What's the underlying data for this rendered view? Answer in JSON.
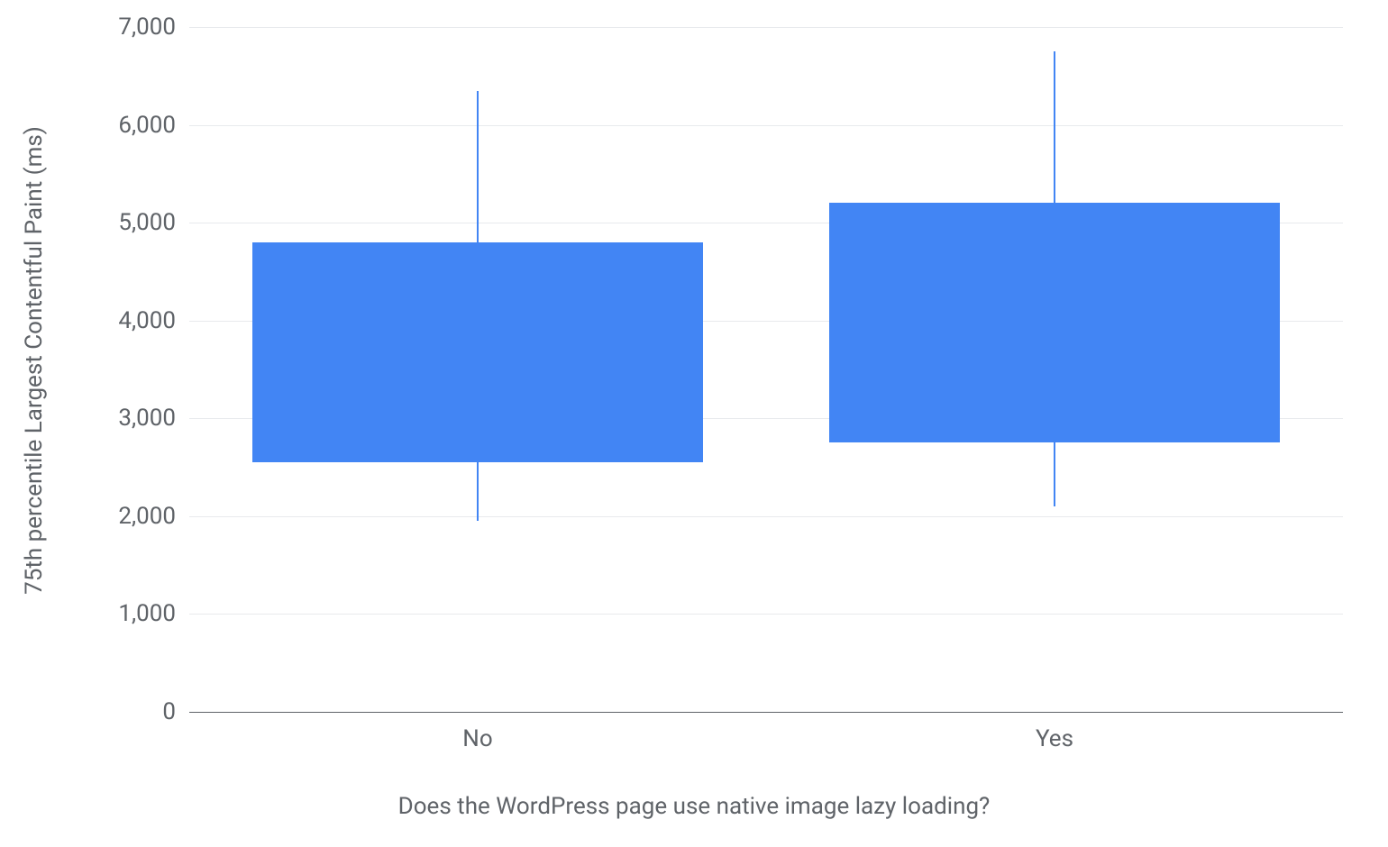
{
  "chart_data": {
    "type": "box",
    "xlabel": "Does the WordPress page use native image lazy loading?",
    "ylabel": "75th percentile Largest Contentful Paint (ms)",
    "ylim": [
      0,
      7000
    ],
    "y_ticks": [
      0,
      1000,
      2000,
      3000,
      4000,
      5000,
      6000,
      7000
    ],
    "y_tick_labels": [
      "0",
      "1,000",
      "2,000",
      "3,000",
      "4,000",
      "5,000",
      "6,000",
      "7,000"
    ],
    "categories": [
      "No",
      "Yes"
    ],
    "series": [
      {
        "name": "No",
        "whisker_low": 1950,
        "q1": 2550,
        "q3": 4800,
        "whisker_high": 6350
      },
      {
        "name": "Yes",
        "whisker_low": 2100,
        "q1": 2750,
        "q3": 5200,
        "whisker_high": 6750
      }
    ],
    "box_color": "#4285f4"
  }
}
